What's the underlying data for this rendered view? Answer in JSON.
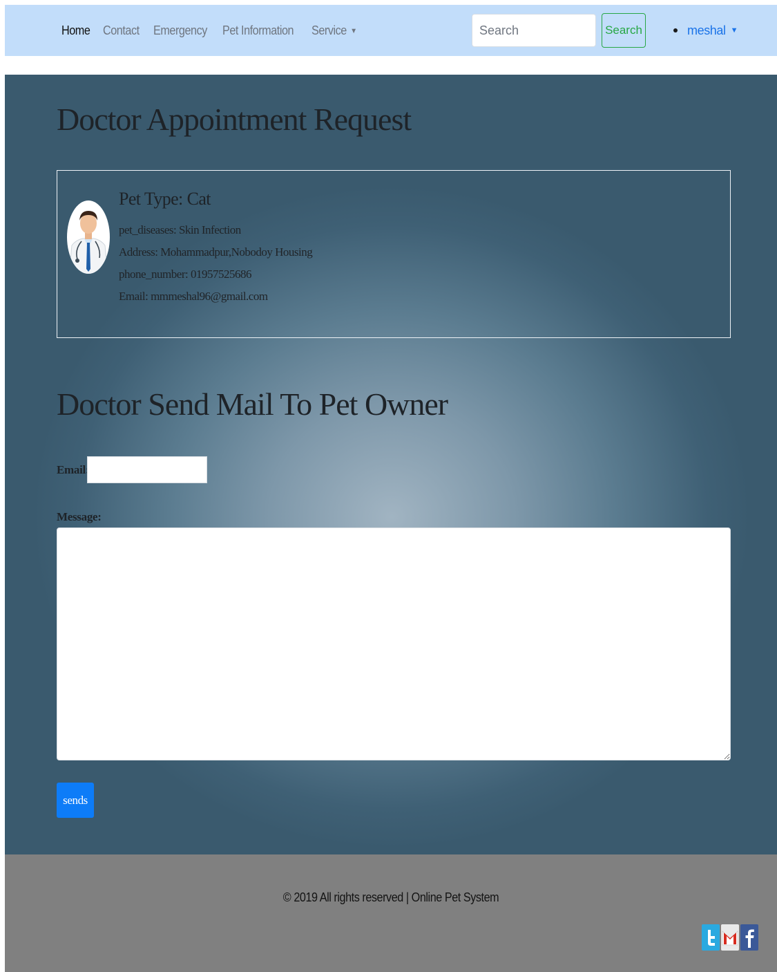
{
  "navbar": {
    "links": [
      "Home",
      "Contact",
      "Emergency",
      "Pet Information",
      "Service"
    ],
    "search_placeholder": "Search",
    "search_button": "Search",
    "user": "meshal",
    "background": "#c2ddfa"
  },
  "appointment": {
    "title": "Doctor Appointment Request",
    "pet_type": "Pet Type: Cat",
    "pet_diseases": "pet_diseases: Skin Infection",
    "address": "Address: Mohammadpur,Nobodoy Housing",
    "phone": "phone_number: 01957525686",
    "email": "Email: mmmeshal96@gmail.com",
    "avatar_icon": "doctor-avatar-icon"
  },
  "mail_form": {
    "title": "Doctor Send Mail To Pet Owner",
    "email_label": "Email:",
    "email_value": "",
    "message_label": "Message:",
    "message_value": "",
    "send_button": "sends",
    "button_color": "#0d7cf8"
  },
  "footer": {
    "copyright": "© 2019 All rights reserved | Online Pet System",
    "social_icons": [
      "twitter-icon",
      "gmail-icon",
      "facebook-icon"
    ],
    "background": "#808080"
  }
}
